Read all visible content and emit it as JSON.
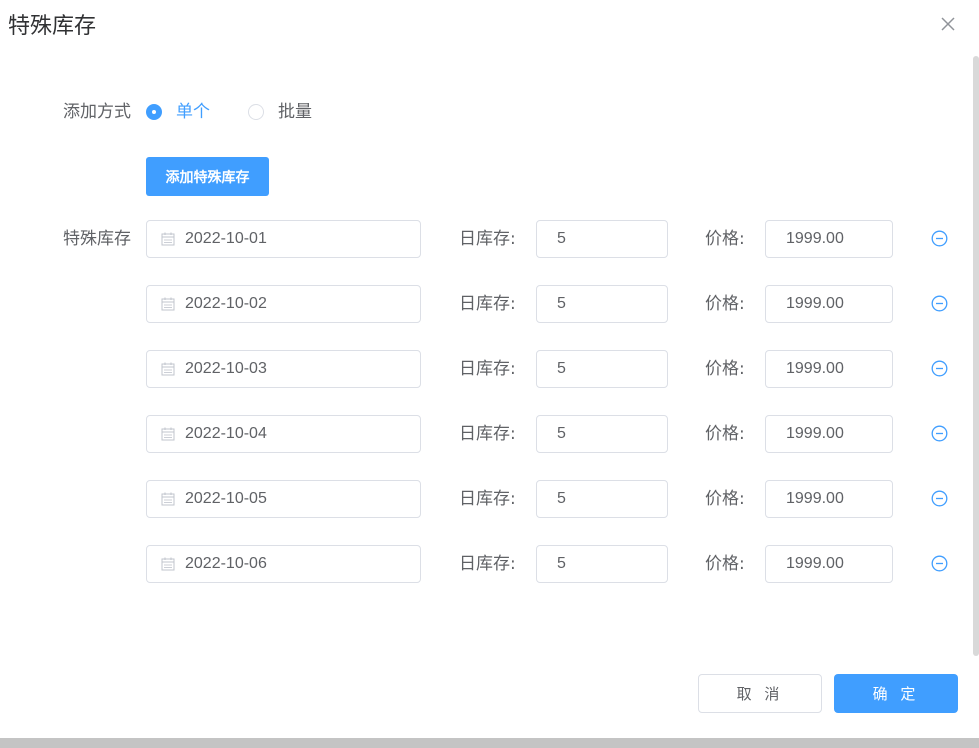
{
  "dialog": {
    "title": "特殊库存"
  },
  "add_mode": {
    "label": "添加方式",
    "options": [
      {
        "label": "单个",
        "checked": true
      },
      {
        "label": "批量",
        "checked": false
      }
    ]
  },
  "add_button": {
    "label": "添加特殊库存"
  },
  "special_stock": {
    "label": "特殊库存",
    "stock_label": "日库存:",
    "price_label": "价格:",
    "rows": [
      {
        "date": "2022-10-01",
        "stock": "5",
        "price": "1999.00"
      },
      {
        "date": "2022-10-02",
        "stock": "5",
        "price": "1999.00"
      },
      {
        "date": "2022-10-03",
        "stock": "5",
        "price": "1999.00"
      },
      {
        "date": "2022-10-04",
        "stock": "5",
        "price": "1999.00"
      },
      {
        "date": "2022-10-05",
        "stock": "5",
        "price": "1999.00"
      },
      {
        "date": "2022-10-06",
        "stock": "5",
        "price": "1999.00"
      }
    ]
  },
  "footer": {
    "cancel_label": "取 消",
    "confirm_label": "确 定"
  },
  "colors": {
    "primary": "#409eff",
    "border": "#dcdfe6",
    "text": "#606266",
    "title": "#303133"
  },
  "icons": {
    "close": "close-icon",
    "calendar": "calendar-icon",
    "remove": "minus-circle-icon"
  }
}
